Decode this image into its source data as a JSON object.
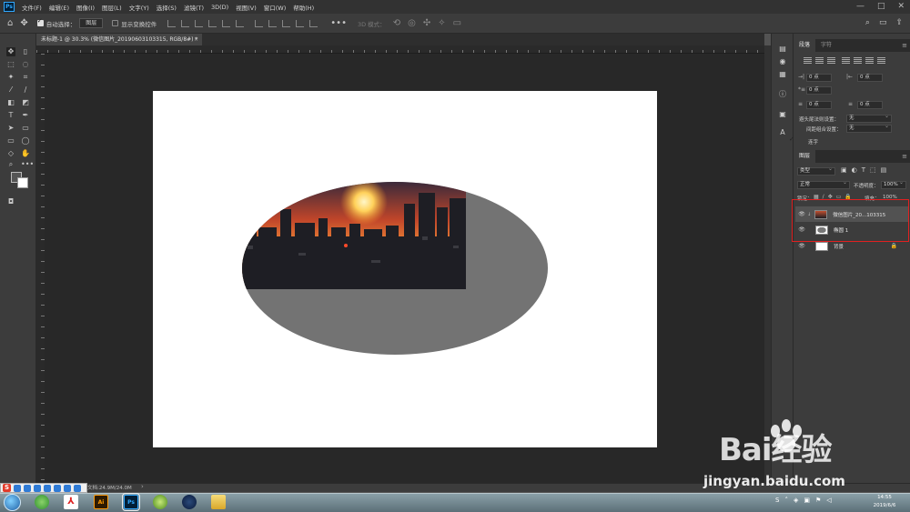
{
  "app": {
    "logo_text": "Ps",
    "menu": [
      "文件(F)",
      "编辑(E)",
      "图像(I)",
      "图层(L)",
      "文字(Y)",
      "选择(S)",
      "滤镜(T)",
      "3D(D)",
      "视图(V)",
      "窗口(W)",
      "帮助(H)"
    ],
    "window_controls": [
      "—",
      "□",
      "✕"
    ]
  },
  "options_bar": {
    "auto_select_label": "自动选择：",
    "auto_select_value": "图层",
    "show_transform_label": "显示变换控件",
    "mode_3d_label": "3D 模式："
  },
  "document": {
    "tab_title": "未标题-1 @ 30.3% (微信图片_20190603103315, RGB/8#) *",
    "tab_close": "×",
    "status_text": "文档:24.9M/24.0M",
    "status_arrow": "›"
  },
  "paragraph_panel": {
    "tabs": [
      "段落",
      "字符"
    ],
    "menu": "≡",
    "indent_left": "0 点",
    "indent_right": "0 点",
    "indent_first": "0 点",
    "space_before": "0 点",
    "space_after": "0 点",
    "hyphen_label": "避头尾法则设置：",
    "hyphen_value": "无",
    "spacing_label": "间距组合设置：",
    "spacing_value": "无",
    "hyphenate_label": "连字"
  },
  "layers_panel": {
    "tab": "图层",
    "menu": "≡",
    "filter_value": "类型",
    "blend_mode": "正常",
    "opacity_label": "不透明度：",
    "opacity_value": "100%",
    "lock_label": "锁定：",
    "fill_label": "填充：",
    "fill_value": "100%",
    "layers": [
      {
        "name": "微信图片_20...103315",
        "selected": true,
        "visible": true
      },
      {
        "name": "椭圆 1",
        "selected": false,
        "visible": true
      },
      {
        "name": "背景",
        "selected": false,
        "visible": true,
        "locked": true
      }
    ]
  },
  "taskbar": {
    "apps": [
      "Ai",
      "Ps"
    ],
    "clock_time": "14:55",
    "clock_date": "2019/6/6"
  },
  "watermark": {
    "brand": "Bai经验",
    "url": "jingyan.baidu.com"
  },
  "colors": {
    "annotation": "#e02020",
    "canvas": "#ffffff",
    "ellipse": "#737373",
    "ps_blue": "#31a8ff"
  }
}
